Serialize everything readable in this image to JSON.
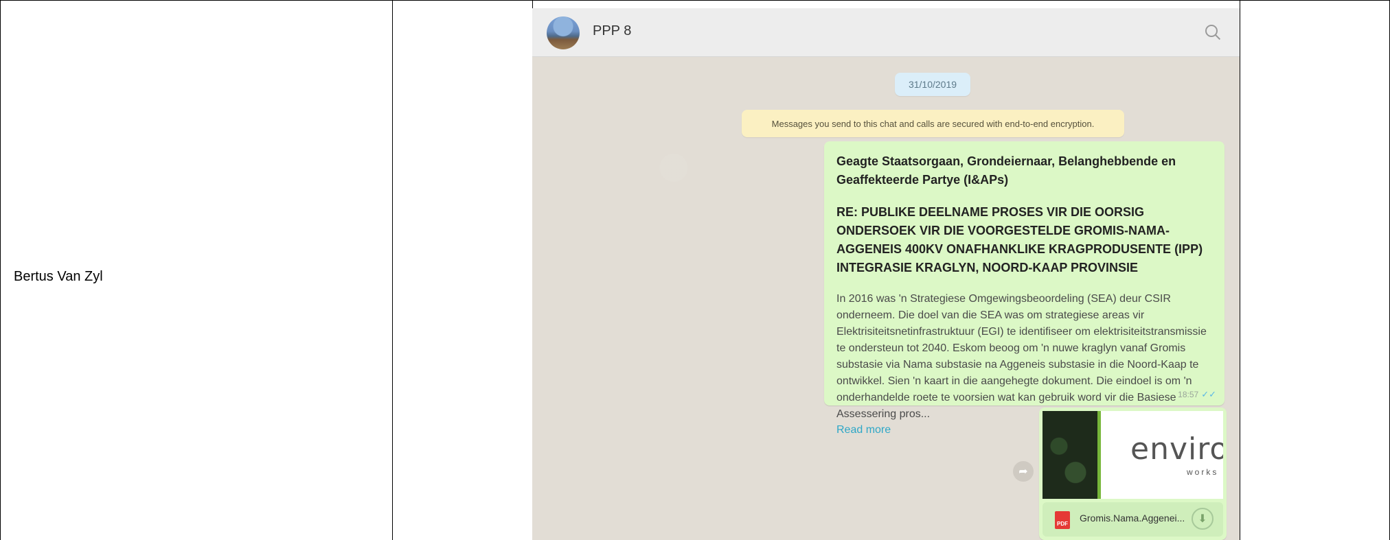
{
  "table": {
    "person_name": "Bertus Van Zyl"
  },
  "chat": {
    "title": "PPP 8",
    "date": "31/10/2019",
    "encryption_notice": "Messages you send to this chat and calls are secured with end-to-end encryption.",
    "message": {
      "heading": "Geagte Staatsorgaan, Grondeiernaar, Belanghebbende en Geaffekteerde Partye (I&APs)",
      "subject": "RE: PUBLIKE DEELNAME PROSES VIR DIE OORSIG ONDERSOEK VIR DIE VOORGESTELDE GROMIS-NAMA-AGGENEIS 400KV ONAFHANKLIKE KRAGPRODUSENTE (IPP) INTEGRASIE KRAGLYN, NOORD-KAAP PROVINSIE",
      "body": "In 2016 was 'n Strategiese Omgewingsbeoordeling (SEA) deur CSIR onderneem. Die doel van die SEA was om strategiese areas vir Elektrisiteitsnetinfrastruktuur (EGI) te identifiseer om elektrisiteitstransmissie te ondersteun tot 2040. Eskom beoog om 'n nuwe kraglyn vanaf Gromis substasie via Nama substasie na Aggeneis substasie in die Noord-Kaap te ontwikkel. Sien 'n kaart in die aangehegte dokument. Die eindoel is om 'n onderhandelde roete te voorsien wat kan gebruik word vir die Basiese Assessering pros...",
      "read_more": "Read more",
      "time": "18:57",
      "ticks": "✓✓"
    },
    "document": {
      "logo_main": "enviro",
      "logo_sub": "works",
      "pdf_label": "PDF",
      "file_name": "Gromis.Nama.Aggenei..."
    }
  },
  "colors": {
    "outgoing_bubble": "#dcf8c6",
    "read_more": "#2ea7c7"
  }
}
